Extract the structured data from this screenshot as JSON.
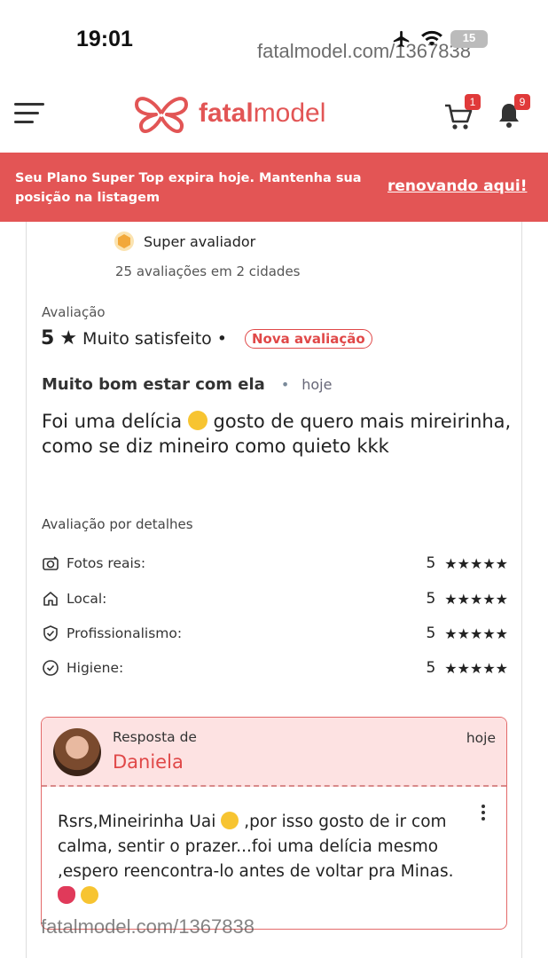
{
  "status_bar": {
    "time": "19:01",
    "battery": "15",
    "watermark": "fatalmodel.com/1367838"
  },
  "header": {
    "logo_text_bold": "fatal",
    "logo_text_light": "model",
    "cart_count": "1",
    "notification_count": "9",
    "accent_color": "#e25555"
  },
  "banner": {
    "message": "Seu Plano Super Top expira hoje. Mantenha sua posição na listagem",
    "link": "renovando aqui!"
  },
  "reviewer": {
    "badge": "Super avaliador",
    "stats": "25 avaliações em 2 cidades"
  },
  "review": {
    "rating_caption": "Avaliação",
    "score": "5",
    "score_label": "Muito satisfeito",
    "new_badge": "Nova avaliação",
    "title": "Muito bom estar com ela",
    "date": "hoje",
    "body_part1": "Foi uma delícia",
    "body_part2": "gosto de quero mais mireirinha, como se diz mineiro como quieto kkk"
  },
  "details": {
    "caption": "Avaliação por detalhes",
    "items": [
      {
        "label": "Fotos reais:",
        "score": "5",
        "stars": "★★★★★",
        "icon": "camera-icon"
      },
      {
        "label": "Local:",
        "score": "5",
        "stars": "★★★★★",
        "icon": "home-icon"
      },
      {
        "label": "Profissionalismo:",
        "score": "5",
        "stars": "★★★★★",
        "icon": "shield-check-icon"
      },
      {
        "label": "Higiene:",
        "score": "5",
        "stars": "★★★★★",
        "icon": "check-circle-icon"
      }
    ]
  },
  "reply": {
    "from_label": "Resposta de",
    "name": "Daniela",
    "date": "hoje",
    "body_part1": "Rsrs,Mineirinha Uai",
    "body_part2": ",por isso gosto de ir com calma, sentir o prazer...foi uma delícia mesmo ,espero reencontra-lo antes de voltar pra Minas."
  },
  "watermark_bottom": "fatalmodel.com/1367838"
}
